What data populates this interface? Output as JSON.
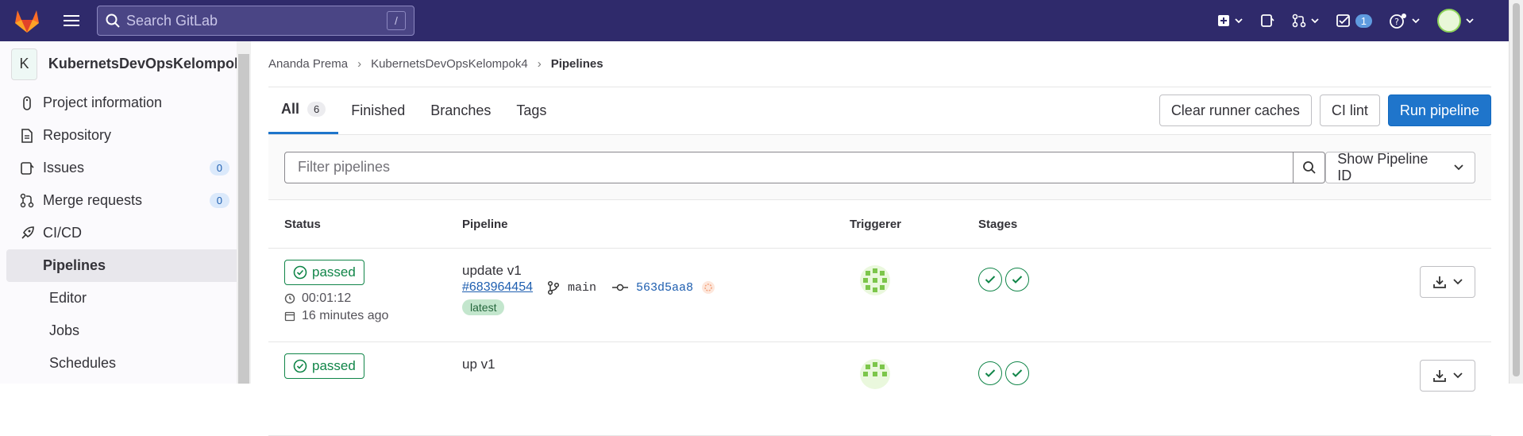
{
  "search": {
    "placeholder": "Search GitLab",
    "shortcut": "/"
  },
  "topbar": {
    "todo_count": "1"
  },
  "sidebar": {
    "project_initial": "K",
    "project_name": "KubernetsDevOpsKelompok4",
    "items": [
      {
        "label": "Project information",
        "icon": "info-icon"
      },
      {
        "label": "Repository",
        "icon": "doc-icon"
      },
      {
        "label": "Issues",
        "icon": "issues-icon",
        "count": "0"
      },
      {
        "label": "Merge requests",
        "icon": "merge-request-icon",
        "count": "0"
      },
      {
        "label": "CI/CD",
        "icon": "rocket-icon"
      }
    ],
    "cicd_sub": [
      "Pipelines",
      "Editor",
      "Jobs",
      "Schedules"
    ]
  },
  "breadcrumb": [
    "Ananda Prema",
    "KubernetsDevOpsKelompok4",
    "Pipelines"
  ],
  "tabs": [
    {
      "label": "All",
      "count": "6"
    },
    {
      "label": "Finished"
    },
    {
      "label": "Branches"
    },
    {
      "label": "Tags"
    }
  ],
  "actions": {
    "clear": "Clear runner caches",
    "lint": "CI lint",
    "run": "Run pipeline"
  },
  "filter": {
    "placeholder": "Filter pipelines",
    "pid_select": "Show Pipeline ID"
  },
  "table": {
    "headers": {
      "status": "Status",
      "pipeline": "Pipeline",
      "triggerer": "Triggerer",
      "stages": "Stages"
    },
    "rows": [
      {
        "status": "passed",
        "duration": "00:01:12",
        "finished": "16 minutes ago",
        "title": "update v1",
        "id": "#683964454",
        "branch": "main",
        "sha": "563d5aa8",
        "tag": "latest"
      },
      {
        "status": "passed",
        "title": "up v1"
      }
    ]
  },
  "colors": {
    "nav": "#2f2a6b",
    "primary": "#1f75cb",
    "success": "#108548"
  }
}
